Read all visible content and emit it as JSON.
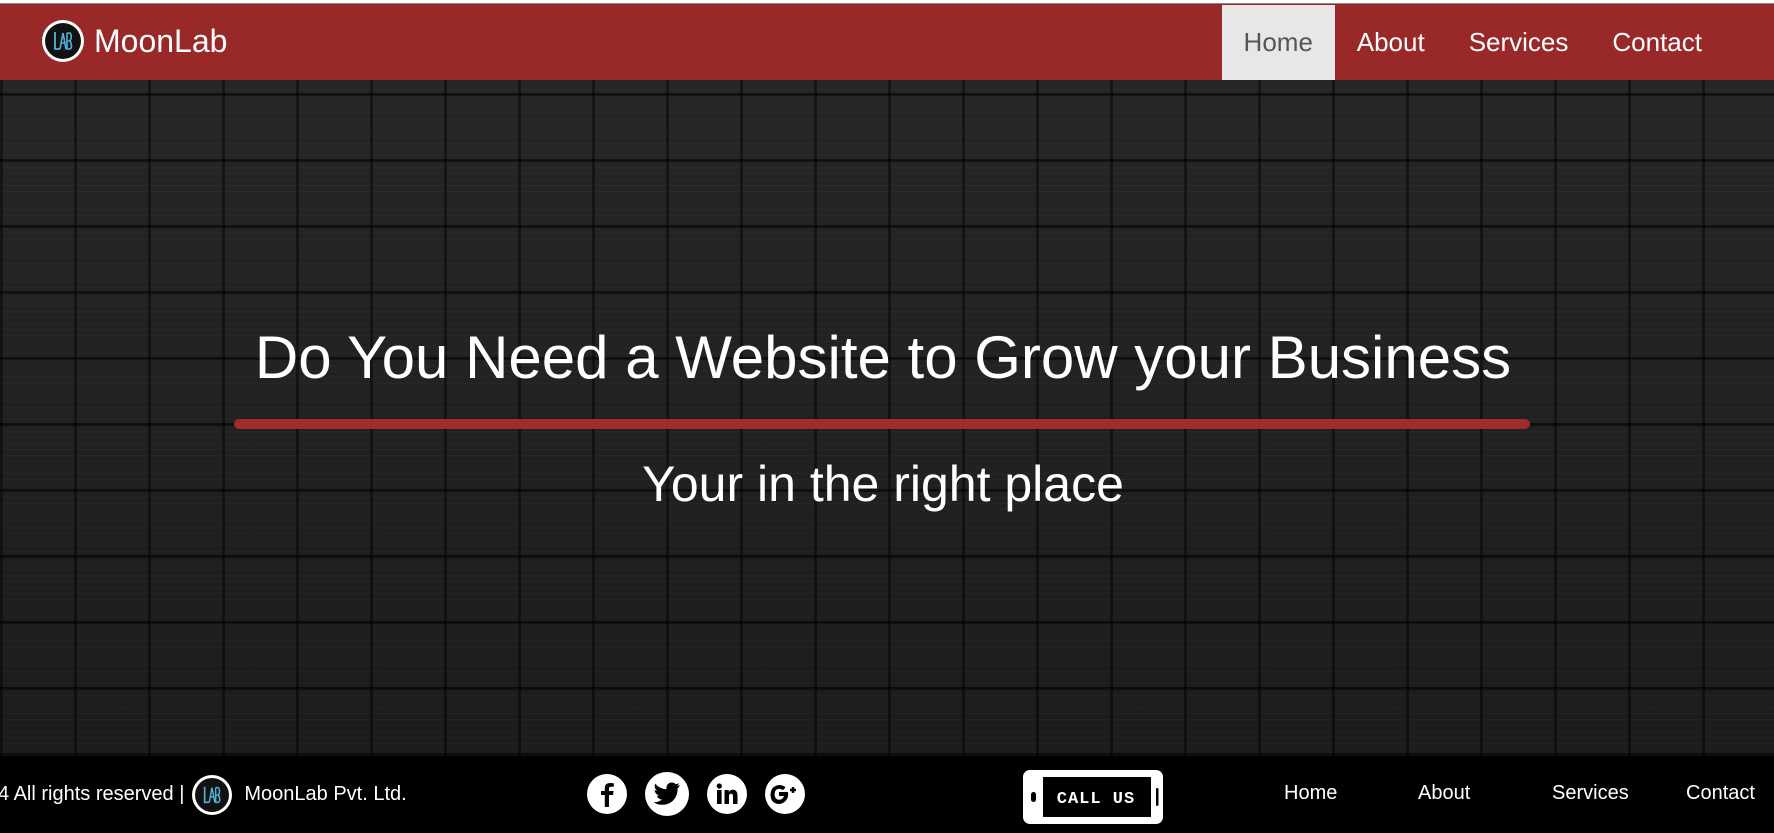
{
  "header": {
    "brand": "MoonLab",
    "logo_text": "LAB",
    "nav": [
      {
        "label": "Home",
        "active": true
      },
      {
        "label": "About",
        "active": false
      },
      {
        "label": "Services",
        "active": false
      },
      {
        "label": "Contact",
        "active": false
      }
    ],
    "colors": {
      "bar": "#992929",
      "active_tab": "#e7e7e7"
    }
  },
  "hero": {
    "title": "Do You Need a Website to Grow your Business",
    "subtitle": "Your in the right place",
    "rule_color": "#a02b2b"
  },
  "footer": {
    "copyright": "4 All rights reserved |",
    "company": "MoonLab Pvt. Ltd.",
    "socials": [
      {
        "name": "facebook-icon",
        "glyph": "f"
      },
      {
        "name": "twitter-icon",
        "glyph": "t"
      },
      {
        "name": "linkedin-icon",
        "glyph": "in"
      },
      {
        "name": "google-plus-icon",
        "glyph": "g+"
      }
    ],
    "call_us": "CALL US",
    "nav": [
      "Home",
      "About",
      "Services",
      "Contact"
    ]
  }
}
